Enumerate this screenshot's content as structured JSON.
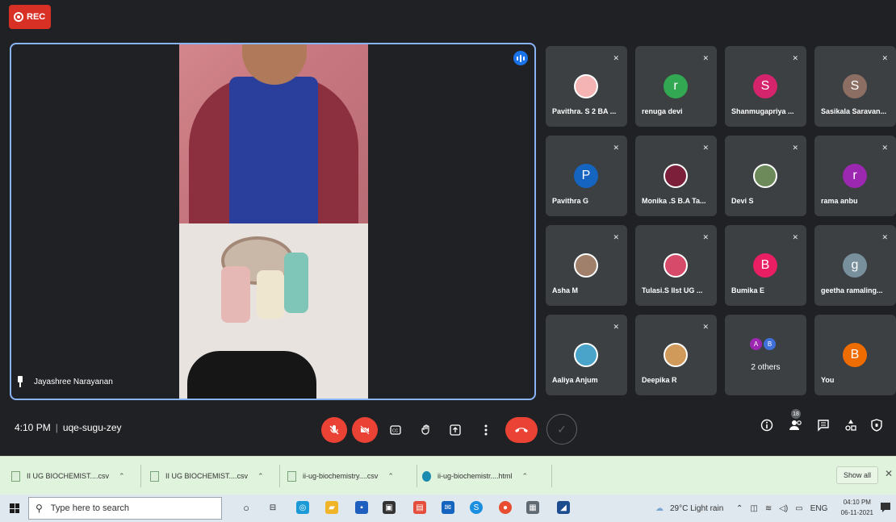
{
  "recording": {
    "label": "REC"
  },
  "main_speaker": {
    "name": "Jayashree Narayanan"
  },
  "participants": [
    {
      "name": "Pavithra. S 2 BA ...",
      "initial": "",
      "color": "#f5b4b4",
      "photo": true
    },
    {
      "name": "renuga devi",
      "initial": "r",
      "color": "#33a852",
      "photo": false
    },
    {
      "name": "Shanmugapriya ...",
      "initial": "S",
      "color": "#d5246c",
      "photo": false
    },
    {
      "name": "Sasikala Saravan...",
      "initial": "S",
      "color": "#8d6e63",
      "photo": false
    },
    {
      "name": "Pavithra G",
      "initial": "P",
      "color": "#1565c0",
      "photo": false
    },
    {
      "name": "Monika .S B.A Ta...",
      "initial": "",
      "color": "#7b1f3a",
      "photo": true
    },
    {
      "name": "Devi S",
      "initial": "",
      "color": "#6d8a5a",
      "photo": true
    },
    {
      "name": "rama anbu",
      "initial": "r",
      "color": "#9c27b0",
      "photo": false
    },
    {
      "name": "Asha M",
      "initial": "",
      "color": "#a0806a",
      "photo": true
    },
    {
      "name": "Tulasi.S IIst UG ...",
      "initial": "",
      "color": "#d84a6a",
      "photo": true
    },
    {
      "name": "Bumika E",
      "initial": "B",
      "color": "#e91e63",
      "photo": false
    },
    {
      "name": "geetha ramaling...",
      "initial": "g",
      "color": "#78909c",
      "photo": false
    },
    {
      "name": "Aaliya Anjum",
      "initial": "",
      "color": "#4aa3c8",
      "photo": true
    },
    {
      "name": "Deepika R",
      "initial": "",
      "color": "#d09a5a",
      "photo": true
    },
    {
      "name": "",
      "initial": "",
      "color": "#3c4043",
      "photo": false,
      "others": true
    },
    {
      "name": "You",
      "initial": "B",
      "color": "#ef6c00",
      "photo": false
    }
  ],
  "others_tile": {
    "label": "2 others",
    "a": "A",
    "b": "B"
  },
  "meeting": {
    "time": "4:10 PM",
    "code": "uqe-sugu-zey",
    "participant_count": "18"
  },
  "downloads": [
    {
      "label": "II UG BIOCHEMIST....csv",
      "type": "csv"
    },
    {
      "label": "II UG BIOCHEMIST....csv",
      "type": "csv"
    },
    {
      "label": "ii-ug-biochemistry....csv",
      "type": "csv"
    },
    {
      "label": "ii-ug-biochemistr....html",
      "type": "html"
    }
  ],
  "download_bar": {
    "show_all": "Show all",
    "close": "✕"
  },
  "taskbar": {
    "search_placeholder": "Type here to search",
    "weather": "29°C  Light rain",
    "lang": "ENG",
    "time": "04:10 PM",
    "date": "06-11-2021"
  },
  "icons": {
    "mic_off": "mic-off-icon",
    "cam_off": "camera-off-icon",
    "captions": "captions-icon",
    "hand": "raise-hand-icon",
    "present": "present-icon",
    "more": "more-options-icon",
    "end": "end-call-icon"
  }
}
